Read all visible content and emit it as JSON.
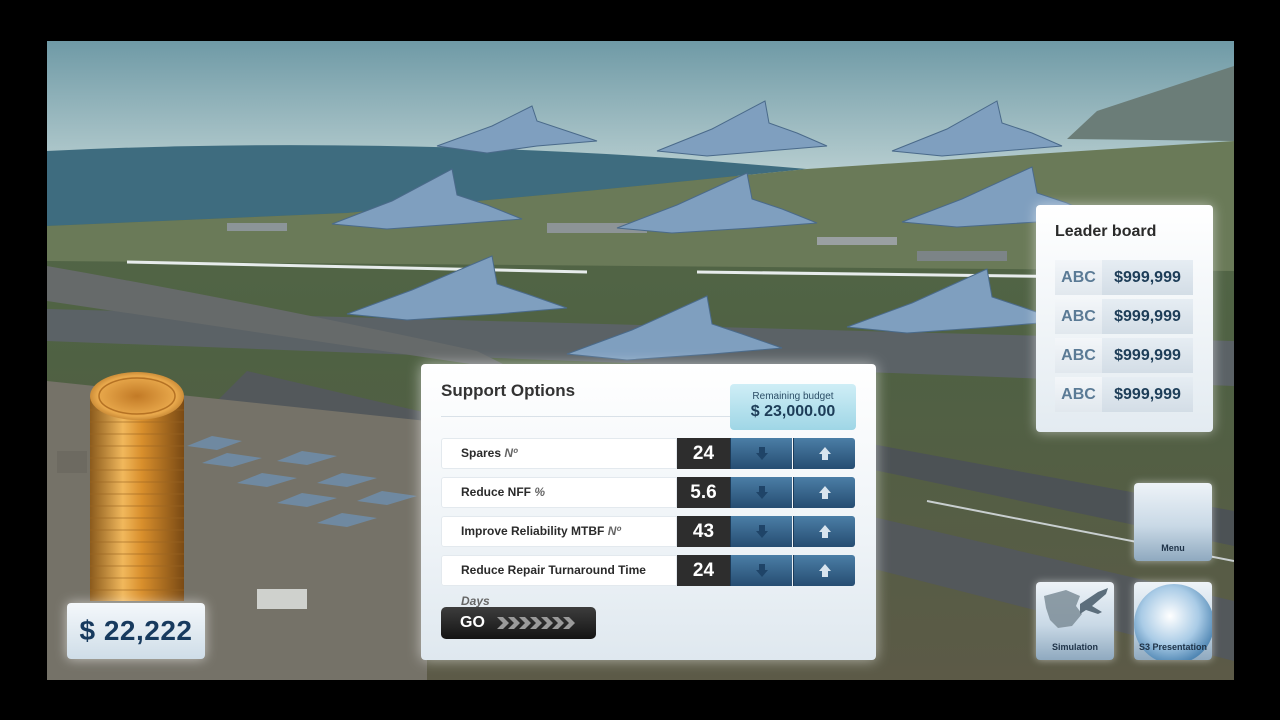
{
  "money": {
    "amount": "$ 22,222"
  },
  "support": {
    "title": "Support Options",
    "budget_label": "Remaining budget",
    "budget_value": "$ 23,000.00",
    "options": [
      {
        "label": "Spares",
        "unit": "Nº",
        "value": "24"
      },
      {
        "label": "Reduce NFF",
        "unit": "%",
        "value": "5.6"
      },
      {
        "label": "Improve Reliability MTBF",
        "unit": "Nº",
        "value": "43"
      },
      {
        "label": "Reduce Repair Turnaround Time",
        "unit": "Days",
        "value": "24"
      }
    ],
    "go_label": "GO"
  },
  "leaderboard": {
    "title": "Leader board",
    "rows": [
      {
        "name": "ABC",
        "score": "$999,999"
      },
      {
        "name": "ABC",
        "score": "$999,999"
      },
      {
        "name": "ABC",
        "score": "$999,999"
      },
      {
        "name": "ABC",
        "score": "$999,999"
      }
    ]
  },
  "nav": {
    "menu_label": "Menu",
    "simulation_label": "Simulation",
    "presentation_label": "S3 Presentation"
  },
  "icons": {
    "down": "arrow-down-icon",
    "up": "arrow-up-icon",
    "go": "chevrons-right-icon"
  }
}
